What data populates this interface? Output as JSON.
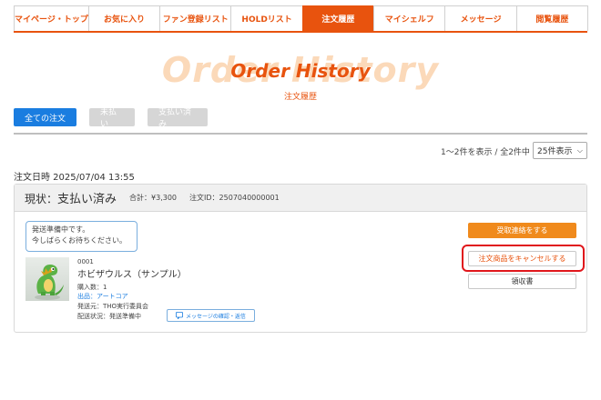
{
  "nav": {
    "items": [
      {
        "label": "マイページ・トップ"
      },
      {
        "label": "お気に入り"
      },
      {
        "label": "ファン登録リスト"
      },
      {
        "label": "HOLDリスト"
      },
      {
        "label": "注文履歴",
        "active": true
      },
      {
        "label": "マイシェルフ"
      },
      {
        "label": "メッセージ"
      },
      {
        "label": "閲覧履歴"
      }
    ]
  },
  "page": {
    "title": "Order History",
    "subtitle": "注文履歴"
  },
  "filters": {
    "all": "全ての注文",
    "unpaid": "未払い",
    "paid": "支払い済み"
  },
  "listing": {
    "count_text": "1～2件を表示 / 全2件中",
    "per_page": "25件表示"
  },
  "order": {
    "date_text": "注文日時 2025/07/04 13:55",
    "status_prefix": "現状：",
    "status": "支払い済み",
    "total": "合計：¥3,300",
    "order_id": "注文ID：2507040000001",
    "notice_line1": "発送準備中です。",
    "notice_line2": "今しばらくお待ちください。",
    "item": {
      "code": "0001",
      "name": "ホビザウルス（サンプル）",
      "qty": "購入数：1",
      "seller": "出品：アートコア",
      "shipper": "発送元：THO実行委員会",
      "delivery": "配送状況：発送準備中"
    },
    "message_button": "メッセージの確認・返信",
    "actions": {
      "contact": "受取連絡をする",
      "cancel": "注文商品をキャンセルする",
      "receipt": "領収書"
    }
  },
  "colors": {
    "brand": "#e8530e",
    "accent_blue": "#1a7de0",
    "highlight": "#e0161b"
  }
}
